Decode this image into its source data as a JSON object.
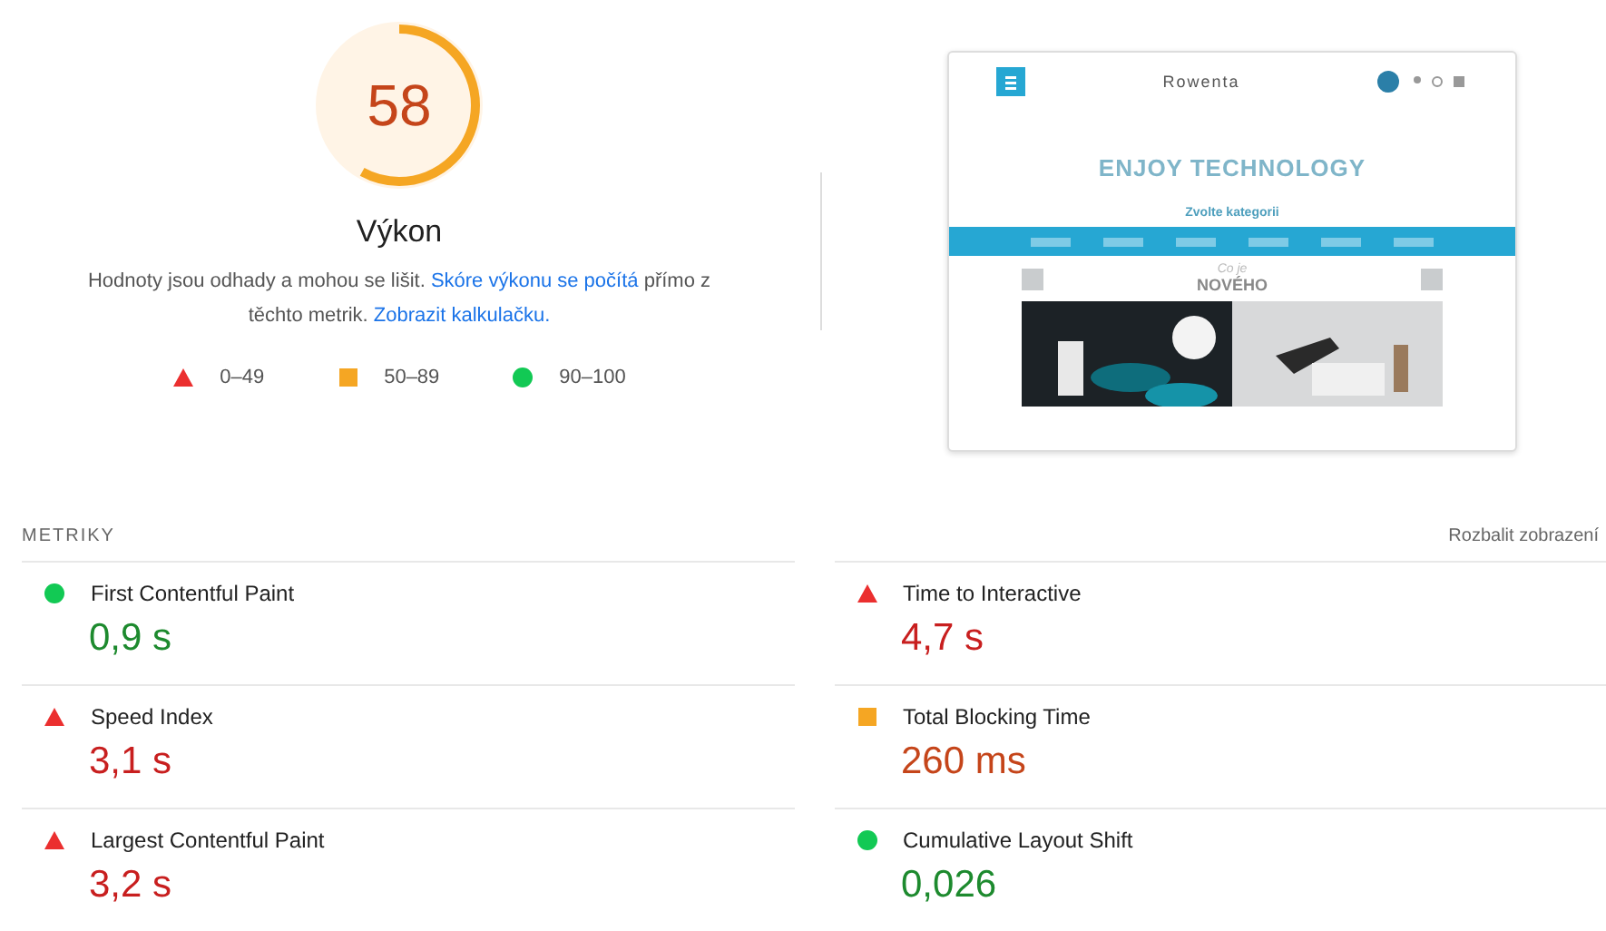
{
  "gauge": {
    "score": "58",
    "level": 0.58,
    "title": "Výkon"
  },
  "description": {
    "text": "Hodnoty jsou odhady a mohou se lišit. ",
    "link1": "Skóre výkonu se počítá",
    "middle": " přímo z těchto metrik. ",
    "link2": "Zobrazit kalkulačku."
  },
  "legend": [
    {
      "kind": "fail",
      "label": "0–49"
    },
    {
      "kind": "average",
      "label": "50–89"
    },
    {
      "kind": "pass",
      "label": "90–100"
    }
  ],
  "screenshot": {
    "logo": "Rowenta",
    "hero_title": "ENJOY TECHNOLOGY",
    "hero_subtitle": "Zvolte kategorii",
    "section_kicker": "Co je",
    "section_title": "NOVÉHO"
  },
  "metrics_header": {
    "title": "METRIKY",
    "toggle": "Rozbalit zobrazení"
  },
  "metrics": [
    {
      "kind": "pass",
      "name": "First Contentful Paint",
      "value": "0,9 s"
    },
    {
      "kind": "fail",
      "name": "Time to Interactive",
      "value": "4,7 s"
    },
    {
      "kind": "fail",
      "name": "Speed Index",
      "value": "3,1 s"
    },
    {
      "kind": "average",
      "name": "Total Blocking Time",
      "value": "260 ms"
    },
    {
      "kind": "fail",
      "name": "Largest Contentful Paint",
      "value": "3,2 s"
    },
    {
      "kind": "pass",
      "name": "Cumulative Layout Shift",
      "value": "0,026"
    }
  ]
}
